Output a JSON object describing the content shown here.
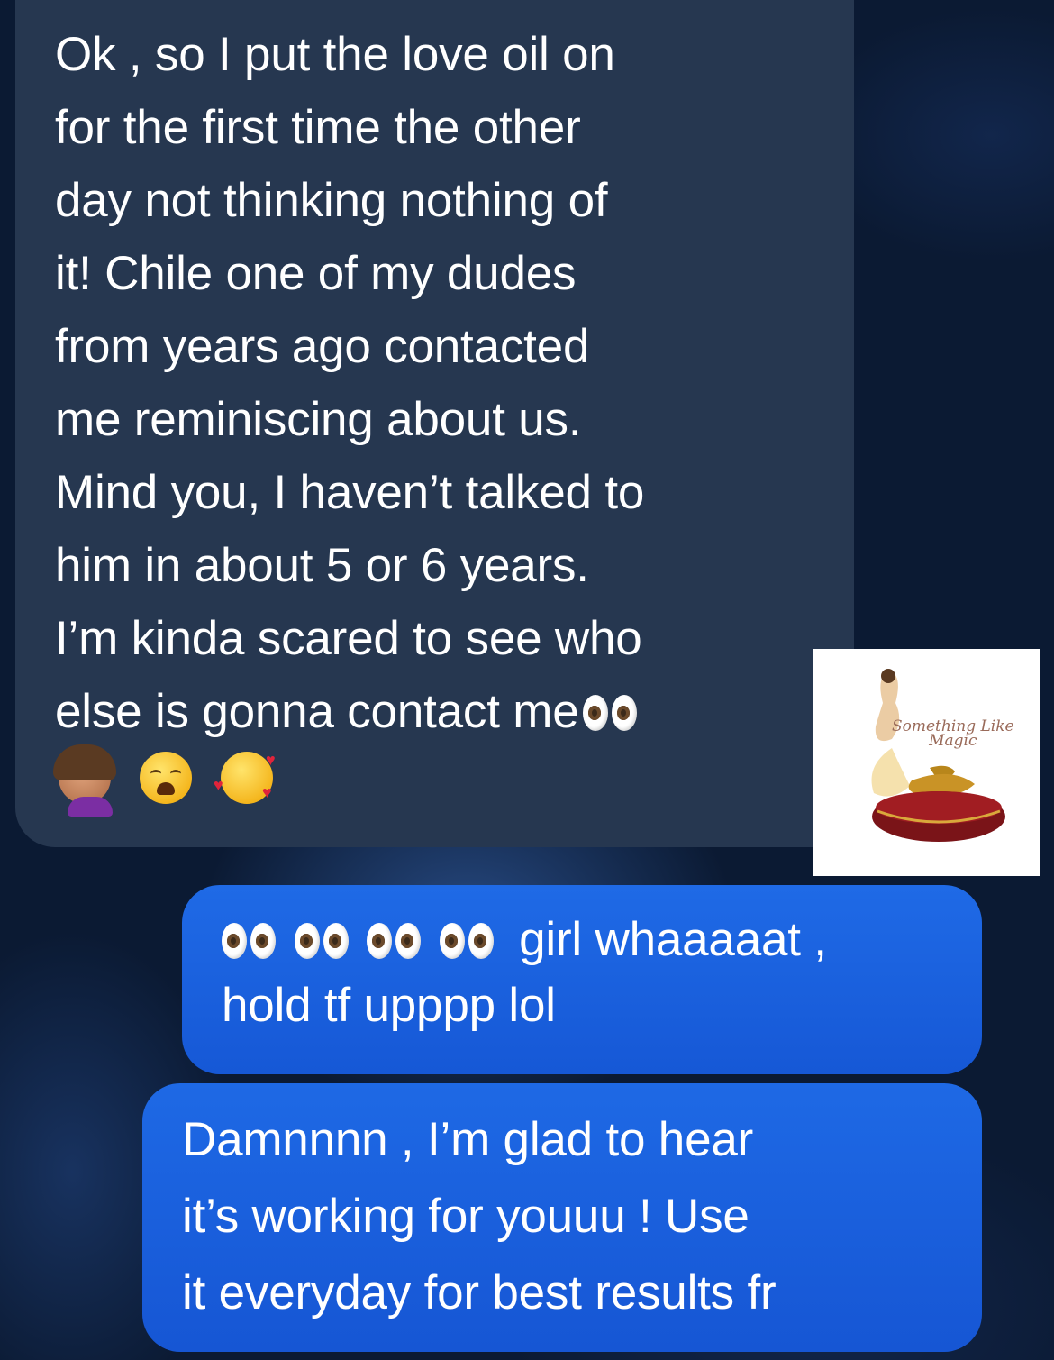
{
  "messages": [
    {
      "id": "incoming",
      "sender": "them",
      "lines": [
        "Ok , so I put the love oil on",
        "for the first time the other",
        "day not thinking nothing of",
        "it! Chile one of my dudes",
        "from years ago contacted",
        "me reminiscing about us.",
        "Mind you, I haven’t talked to",
        "him in about 5 or 6 years.",
        "I’m kinda scared to see who",
        "else is gonna contact me"
      ],
      "trailing_emoji": [
        "eyes-icon"
      ],
      "emoji_row": [
        "facepalm-icon",
        "weary-face-icon",
        "smiling-face-with-hearts-icon"
      ]
    },
    {
      "id": "outgoing-1",
      "sender": "me",
      "prefix_emoji_count": 4,
      "line1": "girl whaaaaat ,",
      "line2": "hold tf upppp lol"
    },
    {
      "id": "outgoing-2",
      "sender": "me",
      "lines": [
        "Damnnnn , I’m glad to hear",
        "it’s working for youuu ! Use",
        "it everyday for best results fr"
      ]
    }
  ],
  "logo": {
    "text_line1": "Something Like",
    "text_line2": "Magic"
  },
  "colors": {
    "incoming_bubble": "#263750",
    "outgoing_bubble": "#1f6ae6",
    "background": "#0b1a33"
  }
}
